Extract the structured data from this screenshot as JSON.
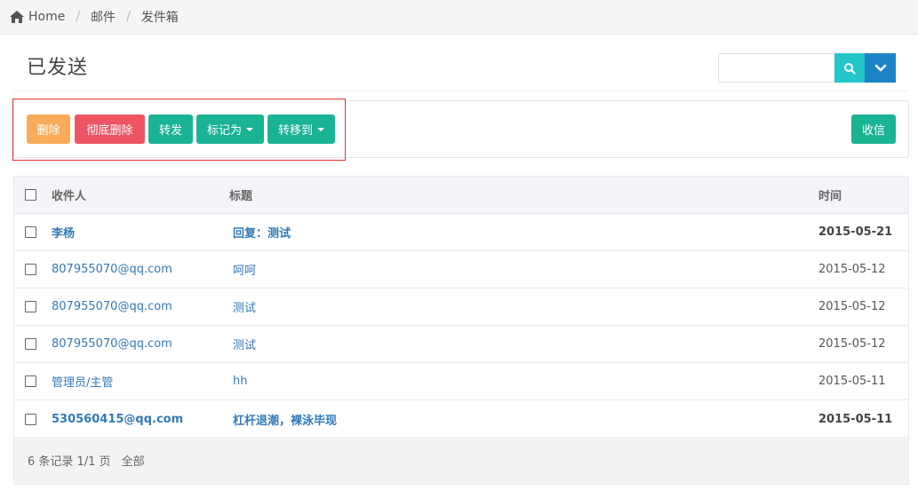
{
  "breadcrumb": {
    "home": "Home",
    "mail": "邮件",
    "current": "发件箱"
  },
  "title": "已发送",
  "search": {
    "placeholder": ""
  },
  "toolbar": {
    "delete": "删除",
    "purge": "彻底删除",
    "forward": "转发",
    "mark_as": "标记为",
    "move_to": "转移到",
    "receive": "收信"
  },
  "table": {
    "headers": {
      "recipient": "收件人",
      "subject": "标题",
      "time": "时间"
    },
    "rows": [
      {
        "recipient": "李杨",
        "subject": "回复：测试",
        "time": "2015-05-21",
        "unread": true
      },
      {
        "recipient": "807955070@qq.com",
        "subject": "呵呵",
        "time": "2015-05-12",
        "unread": false
      },
      {
        "recipient": "807955070@qq.com",
        "subject": "测试",
        "time": "2015-05-12",
        "unread": false
      },
      {
        "recipient": "807955070@qq.com",
        "subject": "测试",
        "time": "2015-05-12",
        "unread": false
      },
      {
        "recipient": "管理员/主管",
        "subject": "hh",
        "time": "2015-05-11",
        "unread": false
      },
      {
        "recipient": "530560415@qq.com",
        "subject": "杠杆退潮，裸泳毕现",
        "time": "2015-05-11",
        "unread": true
      }
    ]
  },
  "pagination": {
    "summary": "6 条记录 1/1 页",
    "all": "全部"
  },
  "icons": {
    "home": "home-icon",
    "search": "search-icon",
    "dropdown": "chevron-down-icon"
  },
  "colors": {
    "warning": "#f8ac59",
    "danger": "#ed5565",
    "primary": "#1ab394",
    "info": "#23c6c8",
    "success": "#1c84c6",
    "link": "#337ab7"
  }
}
